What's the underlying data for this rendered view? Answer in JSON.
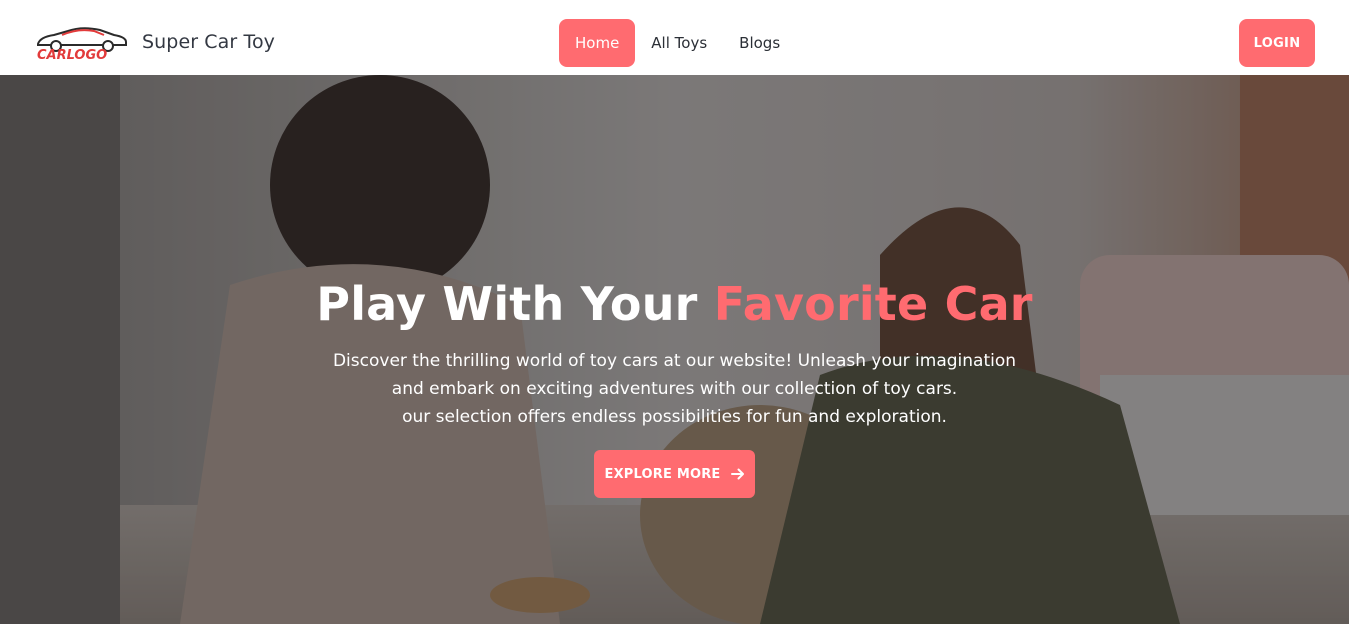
{
  "brand": {
    "logo_text": "CARLOGO",
    "name": "Super Car Toy"
  },
  "nav": {
    "items": [
      {
        "label": "Home",
        "active": true
      },
      {
        "label": "All Toys",
        "active": false
      },
      {
        "label": "Blogs",
        "active": false
      }
    ],
    "login_label": "LOGIN"
  },
  "hero": {
    "title_main": "Play With Your ",
    "title_accent": "Favorite Car",
    "description_lines": [
      "Discover the thrilling world of toy cars at our website! Unleash your imagination",
      "and embark on exciting adventures with our collection of toy cars.",
      "our selection offers endless possibilities for fun and exploration."
    ],
    "cta_label": "EXPLORE MORE",
    "cta_icon": "arrow-right-icon",
    "background_image": "two children playing on a bedroom floor"
  },
  "colors": {
    "accent": "#ff6b70",
    "nav_text": "#2b2f36",
    "hero_text": "#ffffff"
  }
}
